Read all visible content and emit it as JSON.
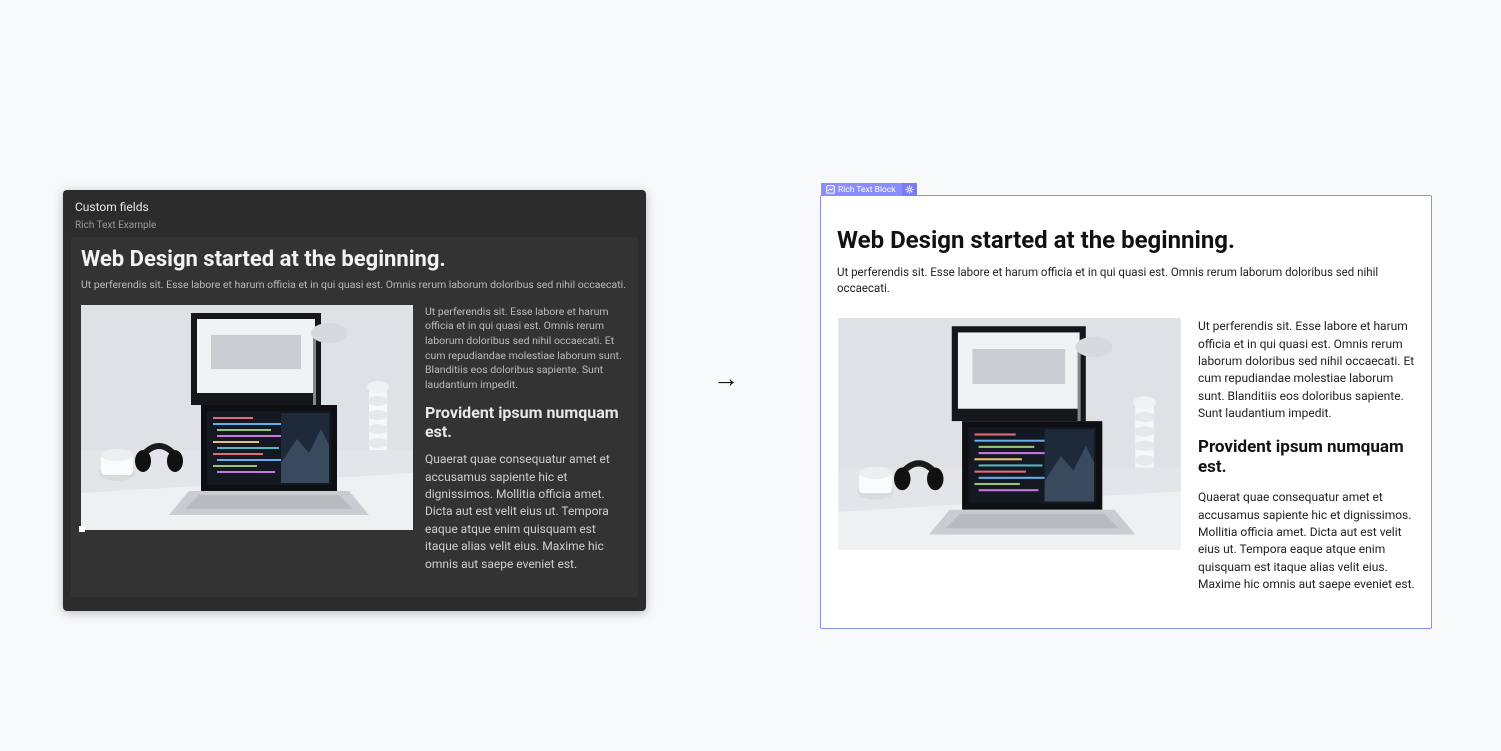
{
  "editor": {
    "panel_title": "Custom fields",
    "field_label": "Rich Text Example",
    "content": {
      "title": "Web Design started at the beginning.",
      "intro": "Ut perferendis sit. Esse labore et harum officia et in qui quasi est. Omnis rerum laborum doloribus sed nihil occaecati.",
      "para1": "Ut perferendis sit. Esse labore et harum officia et in qui quasi est. Omnis rerum laborum doloribus sed nihil occaecati. Et cum repudiandae molestiae laborum sunt. Blanditiis eos doloribus sapiente. Sunt laudantium impedit.",
      "subheading": "Provident ipsum numquam est.",
      "para2": "Quaerat quae consequatur amet et accusamus sapiente hic et dignissimos. Mollitia officia amet. Dicta aut est velit eius ut. Tempora eaque atque enim quisquam est itaque alias velit eius. Maxime hic omnis aut saepe eveniet est."
    }
  },
  "arrow": "→",
  "render": {
    "block_label": "Rich Text Block",
    "title": "Web Design started at the beginning.",
    "intro": "Ut perferendis sit. Esse labore et harum officia et in qui quasi est. Omnis rerum laborum doloribus sed nihil occaecati.",
    "para1": "Ut perferendis sit. Esse labore et harum officia et in qui quasi est. Omnis rerum laborum doloribus sed nihil occaecati. Et cum repudiandae molestiae laborum sunt. Blanditiis eos doloribus sapiente. Sunt laudantium impedit.",
    "subheading": "Provident ipsum numquam est.",
    "para2": "Quaerat quae consequatur amet et accusamus sapiente hic et dignissimos. Mollitia officia amet. Dicta aut est velit eius ut. Tempora eaque atque enim quisquam est itaque alias velit eius. Maxime hic omnis aut saepe eveniet est."
  }
}
